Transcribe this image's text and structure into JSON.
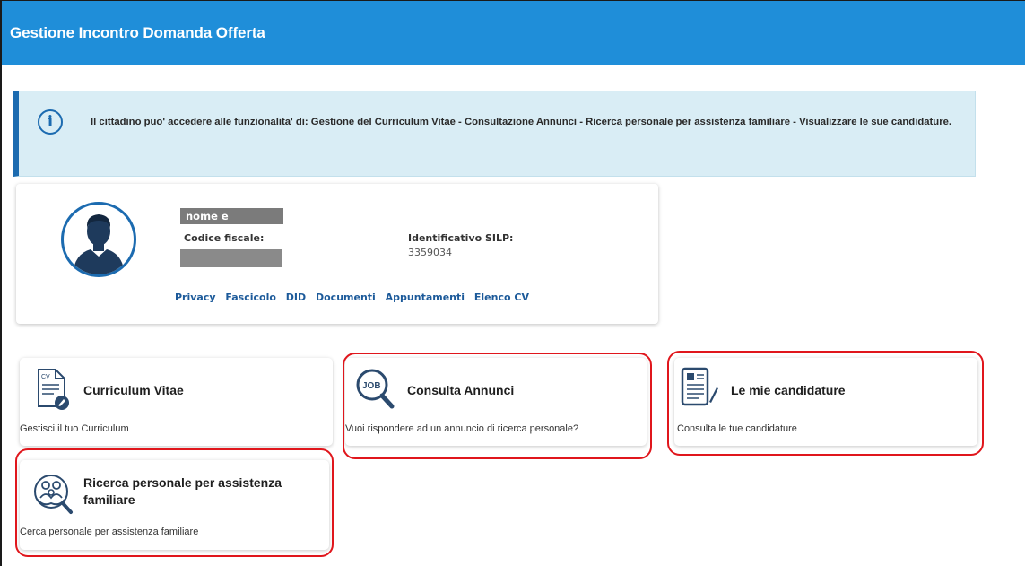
{
  "header": {
    "title": "Gestione Incontro Domanda Offerta"
  },
  "info": {
    "icon": "info-circle-icon",
    "text": "Il cittadino puo' accedere alle funzionalita' di: Gestione del Curriculum Vitae - Consultazione Annunci - Ricerca personale per assistenza familiare - Visualizzare le sue candidature."
  },
  "profile": {
    "avatar_icon": "user-avatar-icon",
    "name": "nome e cognome",
    "codice_fiscale_label": "Codice fiscale:",
    "silp_label": "Identificativo SILP:",
    "silp_value": "3359034",
    "links": [
      "Privacy",
      "Fascicolo",
      "DID",
      "Documenti",
      "Appuntamenti",
      "Elenco CV"
    ]
  },
  "tiles": {
    "cv": {
      "title": "Curriculum Vitae",
      "desc": "Gestisci il tuo Curriculum",
      "icon": "cv-document-icon"
    },
    "annunci": {
      "title": "Consulta Annunci",
      "desc": "Vuoi rispondere ad un annuncio di ricerca personale?",
      "icon": "job-search-icon"
    },
    "candidature": {
      "title": "Le mie candidature",
      "desc": "Consulta le tue candidature",
      "icon": "clipboard-icon"
    },
    "ricerca": {
      "title": "Ricerca personale per assistenza familiare",
      "desc": "Cerca personale per assistenza familiare",
      "icon": "family-care-icon"
    }
  },
  "colors": {
    "header": "#1f8ed9",
    "accent": "#1c6bb0",
    "highlight": "#e0161c",
    "info_bg": "#d9edf5"
  }
}
